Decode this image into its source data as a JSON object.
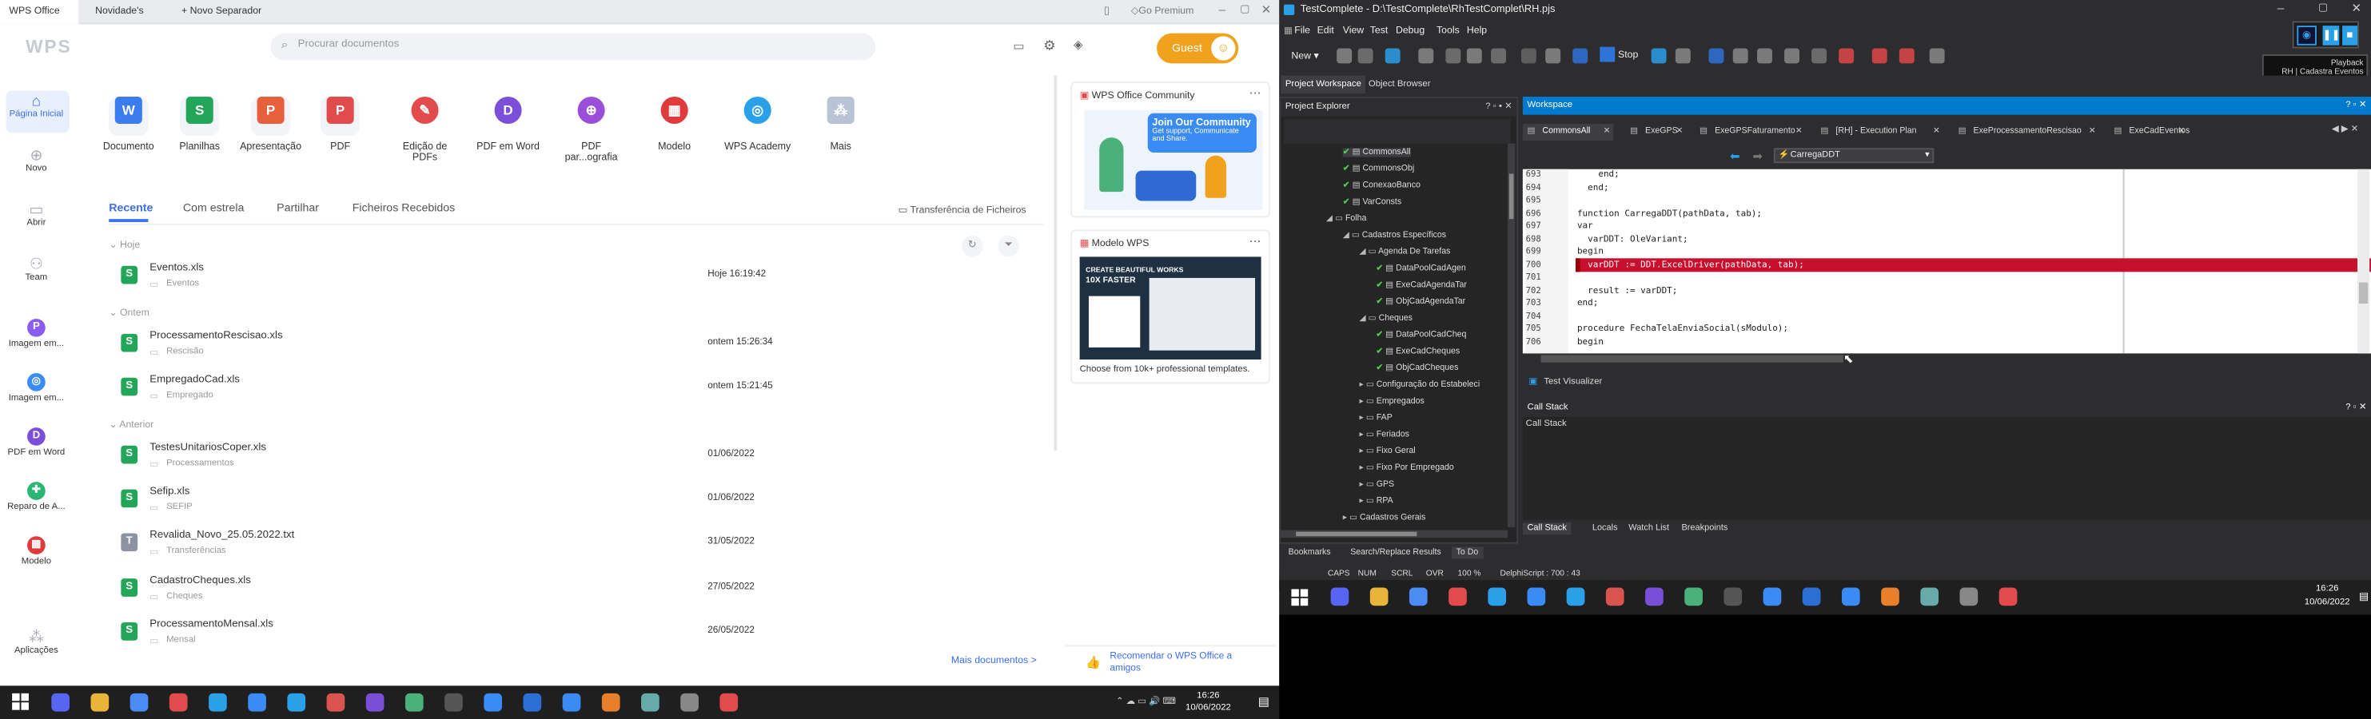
{
  "wps": {
    "tabs": {
      "office": "WPS Office",
      "news": "Novidade's",
      "new": "Novo Separador"
    },
    "premium": "Go Premium",
    "logo": "WPS",
    "search_placeholder": "Procurar documentos",
    "guest_label": "Guest",
    "sidebar": [
      {
        "label": "Página Inicial"
      },
      {
        "label": "Novo"
      },
      {
        "label": "Abrir"
      },
      {
        "label": "Team"
      },
      {
        "label": "Imagem em..."
      },
      {
        "label": "Imagem em..."
      },
      {
        "label": "PDF em Word"
      },
      {
        "label": "Reparo de A..."
      },
      {
        "label": "Modelo"
      },
      {
        "label": "Aplicações"
      }
    ],
    "apps": [
      {
        "label": "Documento",
        "color": "#3a7df0",
        "glyph": "W"
      },
      {
        "label": "Planilhas",
        "color": "#23a55a",
        "glyph": "S"
      },
      {
        "label": "Apresentação",
        "color": "#e6603e",
        "glyph": "P"
      },
      {
        "label": "PDF",
        "color": "#e24b4b",
        "glyph": "P"
      },
      {
        "label": "Edição de PDFs",
        "color": "#e24b4b",
        "glyph": "✎"
      },
      {
        "label": "PDF em Word",
        "color": "#7b4fd8",
        "glyph": "D"
      },
      {
        "label": "PDF par...ografia",
        "color": "#9b4fd8",
        "glyph": "⊕"
      },
      {
        "label": "Modelo",
        "color": "#e03a3a",
        "glyph": "▦"
      },
      {
        "label": "WPS Academy",
        "color": "#2aa0e8",
        "glyph": "◎"
      },
      {
        "label": "Mais",
        "color": "#b9c3d6",
        "glyph": "⁂"
      }
    ],
    "file_tabs": [
      "Recente",
      "Com estrela",
      "Partilhar",
      "Ficheiros Recebidos"
    ],
    "transfer": "Transferência de Ficheiros",
    "groups": {
      "today": "Hoje",
      "yesterday": "Ontem",
      "older": "Anterior"
    },
    "files": [
      {
        "name": "Eventos.xls",
        "folder": "Eventos",
        "date": "Hoje 16:19:42",
        "type": "S"
      },
      {
        "name": "ProcessamentoRescisao.xls",
        "folder": "Rescisão",
        "date": "ontem 15:26:34",
        "type": "S"
      },
      {
        "name": "EmpregadoCad.xls",
        "folder": "Empregado",
        "date": "ontem 15:21:45",
        "type": "S"
      },
      {
        "name": "TestesUnitariosCoper.xls",
        "folder": "Processamentos",
        "date": "01/06/2022",
        "type": "S"
      },
      {
        "name": "Sefip.xls",
        "folder": "SEFIP",
        "date": "01/06/2022",
        "type": "S"
      },
      {
        "name": "Revalida_Novo_25.05.2022.txt",
        "folder": "Transferências",
        "date": "31/05/2022",
        "type": "T"
      },
      {
        "name": "CadastroCheques.xls",
        "folder": "Cheques",
        "date": "27/05/2022",
        "type": "S"
      },
      {
        "name": "ProcessamentoMensal.xls",
        "folder": "Mensal",
        "date": "26/05/2022",
        "type": "S"
      }
    ],
    "more_docs": "Mais documentos >",
    "community": {
      "title": "WPS Office Community",
      "join": "Join Our Community",
      "sub": "Get support, Communicate and Share."
    },
    "template": {
      "title": "Modelo WPS",
      "banner1": "CREATE BEAUTIFUL WORKS",
      "banner2": "10X FASTER",
      "caption": "Choose from 10k+ professional templates."
    },
    "recommend": "Recomendar o WPS Office a amigos"
  },
  "tc": {
    "title": "TestComplete - D:\\TestComplete\\RhTestComplet\\RH.pjs",
    "menu": [
      "File",
      "Edit",
      "View",
      "Test",
      "Debug",
      "Tools",
      "Help"
    ],
    "toolbar": {
      "new": "New",
      "stop": "Stop"
    },
    "playback": "Playback",
    "playback_sub": "RH | Cadastra Eventos",
    "panel_tabs": [
      "Project Workspace",
      "Object Browser"
    ],
    "explorer_title": "Project Explorer",
    "workspace_title": "Workspace",
    "tree": [
      {
        "label": "CommonsAll",
        "level": 3,
        "check": true
      },
      {
        "label": "CommonsObj",
        "level": 3,
        "check": true
      },
      {
        "label": "ConexaoBanco",
        "level": 3,
        "check": true
      },
      {
        "label": "VarConsts",
        "level": 3,
        "check": true
      },
      {
        "label": "Folha",
        "level": 2,
        "check": false
      },
      {
        "label": "Cadastros Específicos",
        "level": 3,
        "check": false
      },
      {
        "label": "Agenda De Tarefas",
        "level": 4,
        "check": false
      },
      {
        "label": "DataPoolCadAgen",
        "level": 5,
        "check": true
      },
      {
        "label": "ExeCadAgendaTar",
        "level": 5,
        "check": true
      },
      {
        "label": "ObjCadAgendaTar",
        "level": 5,
        "check": true
      },
      {
        "label": "Cheques",
        "level": 4,
        "check": false
      },
      {
        "label": "DataPoolCadCheq",
        "level": 5,
        "check": true
      },
      {
        "label": "ExeCadCheques",
        "level": 5,
        "check": true
      },
      {
        "label": "ObjCadCheques",
        "level": 5,
        "check": true
      },
      {
        "label": "Configuração do Estabeleci",
        "level": 4,
        "check": false
      },
      {
        "label": "Empregados",
        "level": 4,
        "check": false
      },
      {
        "label": "FAP",
        "level": 4,
        "check": false
      },
      {
        "label": "Feriados",
        "level": 4,
        "check": false
      },
      {
        "label": "Fixo Geral",
        "level": 4,
        "check": false
      },
      {
        "label": "Fixo Por Empregado",
        "level": 4,
        "check": false
      },
      {
        "label": "GPS",
        "level": 4,
        "check": false
      },
      {
        "label": "RPA",
        "level": 4,
        "check": false
      },
      {
        "label": "Cadastros Gerais",
        "level": 3,
        "check": false
      }
    ],
    "ws_tabs": [
      "CommonsAll",
      "ExeGPS",
      "ExeGPSFaturamento",
      "[RH] - Execution Plan",
      "ExeProcessamentoRescisao",
      "ExeCadEventos"
    ],
    "routine": "CarregaDDT",
    "code": [
      {
        "n": "693",
        "t": "    end;"
      },
      {
        "n": "694",
        "t": "  end;"
      },
      {
        "n": "695",
        "t": ""
      },
      {
        "n": "696",
        "t": "function CarregaDDT(pathData, tab);"
      },
      {
        "n": "697",
        "t": "var"
      },
      {
        "n": "698",
        "t": "  varDDT: OleVariant;"
      },
      {
        "n": "699",
        "t": "begin"
      },
      {
        "n": "700",
        "t": "  varDDT := DDT.ExcelDriver(pathData, tab);"
      },
      {
        "n": "701",
        "t": ""
      },
      {
        "n": "702",
        "t": "  result := varDDT;"
      },
      {
        "n": "703",
        "t": "end;"
      },
      {
        "n": "704",
        "t": ""
      },
      {
        "n": "705",
        "t": "procedure FechaTelaEnviaSocial(sModulo);"
      },
      {
        "n": "706",
        "t": "begin"
      }
    ],
    "visualizer": "Test Visualizer",
    "callstack_title": "Call Stack",
    "callstack_header": "Call Stack",
    "bottom_tabs": [
      "Call Stack",
      "Locals",
      "Watch List",
      "Breakpoints"
    ],
    "explorer_tabs": [
      "Bookmarks",
      "Search/Replace Results",
      "To Do"
    ],
    "status": [
      "CAPS",
      "NUM",
      "SCRL",
      "OVR",
      "100 %",
      "DelphiScript : 700 : 43"
    ]
  },
  "clock": {
    "time": "16:26",
    "date": "10/06/2022"
  },
  "clock2": {
    "time": "16:26",
    "date": "10/06/2022"
  }
}
